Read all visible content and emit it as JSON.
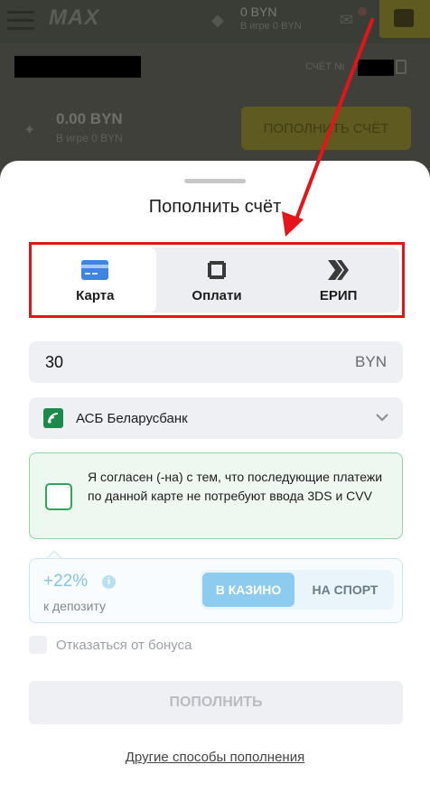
{
  "background": {
    "logo_main": "MAX",
    "logo_sub": "",
    "balance": "0 BYN",
    "balance_sub": "В игре 0 BYN",
    "account_label": "СЧЁТ №",
    "bonus_balance": "0.00 BYN",
    "bonus_balance_sub": "В игре 0 BYN",
    "topup_button": "ПОПОЛНИТЬ СЧЁТ"
  },
  "sheet": {
    "title": "Пополнить счёт",
    "tabs": [
      {
        "label": "Карта",
        "icon": "credit-card-icon",
        "active": true
      },
      {
        "label": "Оплати",
        "icon": "square-frame-icon",
        "active": false
      },
      {
        "label": "ЕРИП",
        "icon": "double-chevron-right-icon",
        "active": false
      }
    ],
    "amount": {
      "value": "30",
      "currency": "BYN"
    },
    "bank": {
      "name": "АСБ Беларусбанк",
      "icon": "belarusbank-logo-icon"
    },
    "consent_text": "Я согласен (-на) с тем, что последующие платежи по данной карте не потребуют ввода 3DS и CVV",
    "bonus": {
      "percent": "+22%",
      "info": "i",
      "subtitle": "к депозиту",
      "options": [
        "В КАЗИНО",
        "НА СПОРТ"
      ],
      "selected": "В КАЗИНО"
    },
    "decline_bonus": "Отказаться от бонуса",
    "submit": "ПОПОЛНИТЬ",
    "other_methods": "Другие способы пополнения"
  },
  "colors": {
    "annotation": "#e5141b",
    "bonus_accent": "#8dccee",
    "consent_border": "#8fd6a6",
    "bank_brand": "#1c8a4b",
    "card_icon": "#3f83e3"
  }
}
